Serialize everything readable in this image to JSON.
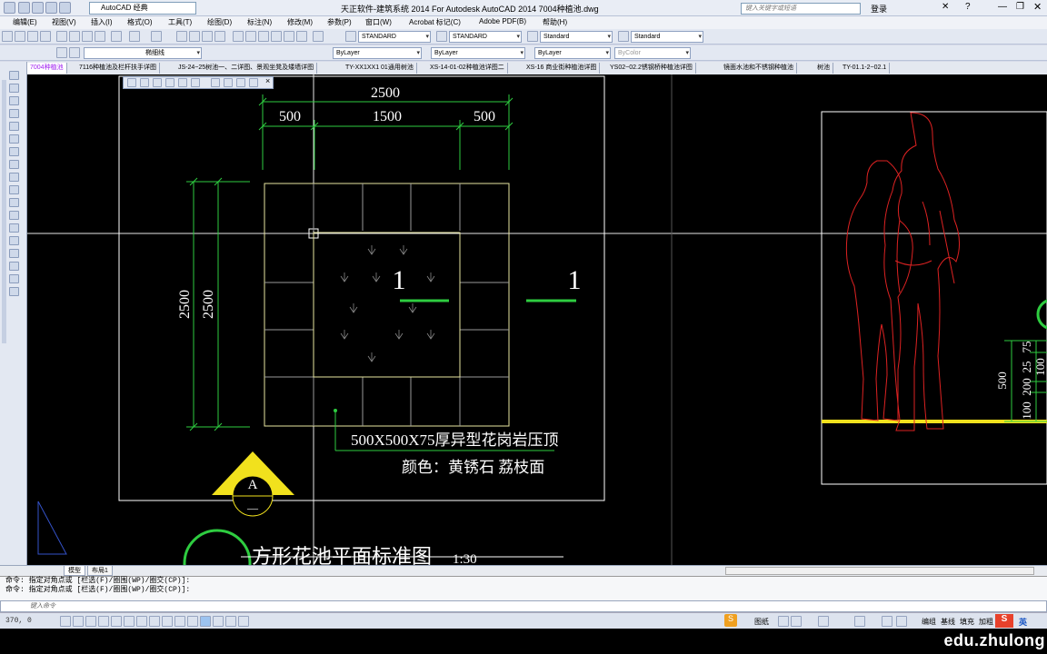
{
  "window": {
    "title": "天正软件-建筑系统 2014  For Autodesk AutoCAD 2014      7004种植池.dwg",
    "workspace": "AutoCAD 经典",
    "search_placeholder": "键入关键字或短语",
    "login": "登录"
  },
  "menu": [
    "编辑(E)",
    "视图(V)",
    "插入(I)",
    "格式(O)",
    "工具(T)",
    "绘图(D)",
    "标注(N)",
    "修改(M)",
    "参数(P)",
    "窗口(W)",
    "Acrobat 标记(C)",
    "Adobe PDF(B)",
    "帮助(H)"
  ],
  "styles": {
    "text_style": "STANDARD",
    "dim_style": "STANDARD",
    "table_style": "Standard",
    "mleader_style": "Standard"
  },
  "layer": {
    "name": "椭细线",
    "color": "ByLayer",
    "linetype": "ByLayer",
    "lineweight": "ByLayer",
    "plotstyle": "ByColor"
  },
  "file_tabs": [
    "7004种植池",
    "7116种植池及栏杆扶手详图",
    "JS-24~25树池一、二详图、景观坐凳及矮墙详图",
    "TY-XX1XX1 01通用树池",
    "XS-14-01-02种植池详图二",
    "XS-16 商业街种植池详图",
    "YS02~02.2锈钢桥种植池详图",
    "镜面水池和不锈钢种植池",
    "树池",
    "TY-01.1-2~02.1"
  ],
  "drawing": {
    "dims_top": {
      "total": "2500",
      "left": "500",
      "mid": "1500",
      "right": "500"
    },
    "dims_left": {
      "a": "2500",
      "b": "2500"
    },
    "section_mark_1": "1",
    "section_mark_2": "1",
    "note_line1": "500X500X75厚异型花岗岩压顶",
    "note_line2": "颜色：黄锈石 荔枝面",
    "index_letter": "A",
    "index_sub": "—",
    "plan_title": "方形花池平面标准图",
    "plan_scale": "1:30",
    "elev_dims": {
      "d500": "500",
      "d100": "100",
      "d200": "200",
      "d25": "25",
      "d75": "75",
      "d100b": "100"
    }
  },
  "layout_tabs": [
    "模型",
    "布局1"
  ],
  "command": {
    "line1": "命令: 指定对角点或 [栏选(F)/圈围(WP)/圈交(CP)]:",
    "line2": "命令: 指定对角点或 [栏选(F)/圈围(WP)/圈交(CP)]:",
    "prompt": "键入命令"
  },
  "status": {
    "coord": "370, 0",
    "paper": "图纸",
    "e1": "编组",
    "e2": "基线",
    "e3": "填充",
    "e4": "加粗",
    "ime": "英"
  },
  "watermark": "edu.zhulong"
}
